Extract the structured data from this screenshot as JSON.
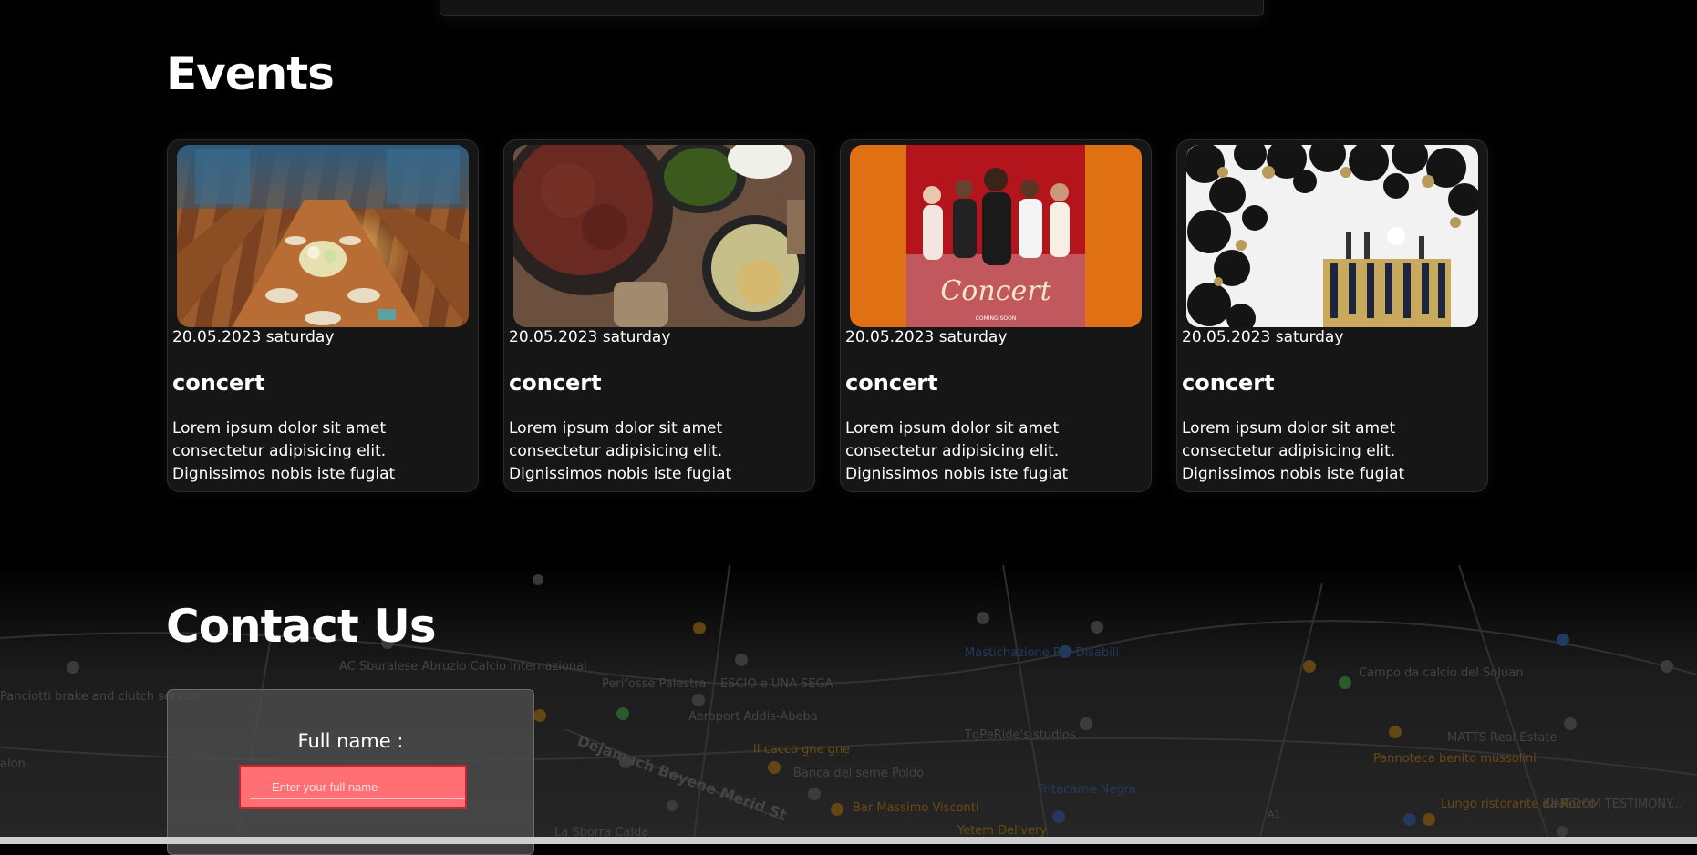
{
  "events": {
    "title": "Events",
    "cards": [
      {
        "date": "20.05.2023 saturday",
        "title": "concert",
        "description": "Lorem ipsum dolor sit amet consectetur adipisicing elit. Dignissimos nobis iste fugiat",
        "image": "banquet-table-photo"
      },
      {
        "date": "20.05.2023 saturday",
        "title": "concert",
        "description": "Lorem ipsum dolor sit amet consectetur adipisicing elit. Dignissimos nobis iste fugiat",
        "image": "ethiopian-food-photo"
      },
      {
        "date": "20.05.2023 saturday",
        "title": "concert",
        "description": "Lorem ipsum dolor sit amet consectetur adipisicing elit. Dignissimos nobis iste fugiat",
        "image": "concert-poster",
        "poster_text": "Concert",
        "poster_subtext": "COMING SOON"
      },
      {
        "date": "20.05.2023 saturday",
        "title": "concert",
        "description": "Lorem ipsum dolor sit amet consectetur adipisicing elit. Dignissimos nobis iste fugiat",
        "image": "balloon-arch-photo"
      }
    ]
  },
  "contact": {
    "title": "Contact Us",
    "form": {
      "full_name_label": "Full name :",
      "full_name_placeholder": "Enter your full name",
      "full_name_value": ""
    },
    "map_labels": [
      "Perifosse Palestra",
      "ESCIO e UNA SEGA",
      "Aeroport Addis-Abeba",
      "Il cacco gne gne",
      "Banca del seme Poldo",
      "Bar Massimo Visconti",
      "TgPeRide's studios",
      "Tritacarne Negra",
      "Yetem Delivery",
      "Mastichazione Per Disabili",
      "Campo da calcio del SoJuan",
      "MATTS Real Estate",
      "Pannoteca benito mussolini",
      "Lungo ristorante da Rocco",
      "KINGDOM TESTIMONY...",
      "La Sborra Calda",
      "Dejamach Beyene Merid St",
      "AC Sburalese Abruzio Calcio internazional",
      "Panciotti brake and clutch service",
      "A1",
      "alon"
    ]
  },
  "colors": {
    "background": "#000000",
    "card_bg": "#161616",
    "input_bg": "#ff6f73",
    "input_border": "#c2262e",
    "poster_orange": "#e07014"
  }
}
